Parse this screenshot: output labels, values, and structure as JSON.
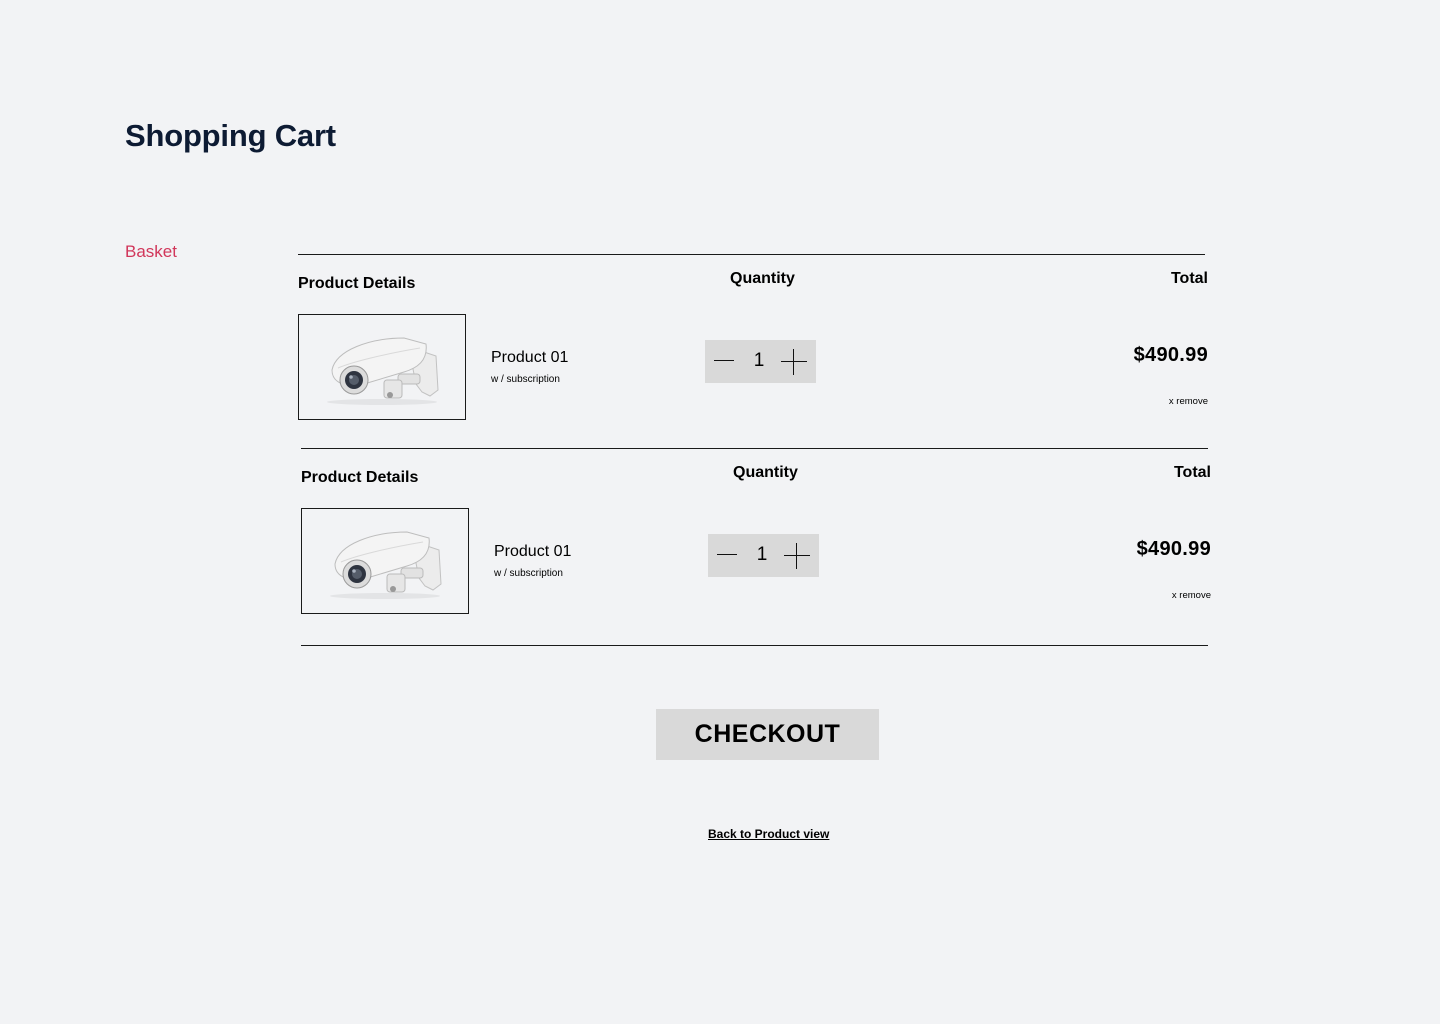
{
  "page": {
    "title": "Shopping Cart"
  },
  "sidebar": {
    "active_label": "Basket"
  },
  "cart": {
    "headers": {
      "product": "Product Details",
      "quantity": "Quantity",
      "total": "Total"
    },
    "items": [
      {
        "name": "Product 01",
        "subtitle": "w / subscription",
        "quantity": "1",
        "price": "$490.99",
        "remove_label": "x remove",
        "image": "security-camera"
      },
      {
        "name": "Product 01",
        "subtitle": "w / subscription",
        "quantity": "1",
        "price": "$490.99",
        "remove_label": "x remove",
        "image": "security-camera"
      }
    ]
  },
  "actions": {
    "checkout_label": "CHECKOUT",
    "back_link": "Back to Product view"
  },
  "colors": {
    "background": "#f2f3f5",
    "title": "#0d1b33",
    "accent": "#d1365a",
    "button_bg": "#d9d9d9"
  }
}
